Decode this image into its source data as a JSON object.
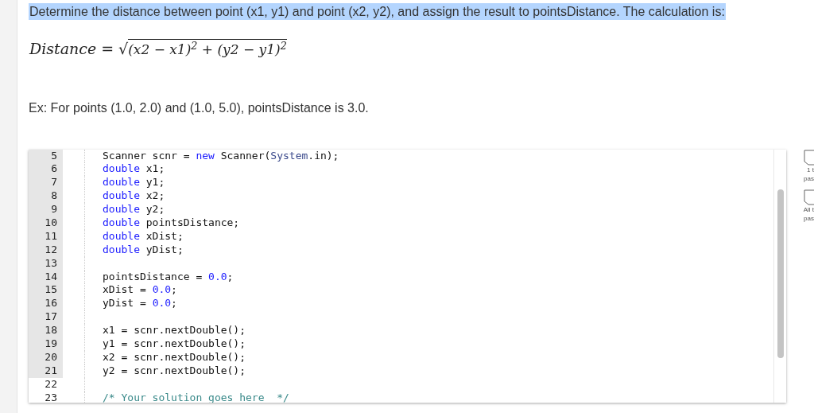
{
  "instruction": {
    "text": "Determine the distance between point (x1, y1) and point (x2, y2), and assign the result to pointsDistance. The calculation is:",
    "highlighted": true
  },
  "formula": {
    "lhs": "Distance",
    "eq": "=",
    "root": "√",
    "radicand": "(x2 − x1)$^{2}$ + (y2 − y1)$^{2}$"
  },
  "example": "Ex: For points (1.0, 2.0) and (1.0, 5.0), pointsDistance is 3.0.",
  "editor": {
    "lines": [
      {
        "number": "5",
        "locked": true,
        "tokens": [
          {
            "kind": "plain",
            "text": "Scanner scnr = "
          },
          {
            "kind": "keyword",
            "text": "new"
          },
          {
            "kind": "plain",
            "text": " Scanner("
          },
          {
            "kind": "type",
            "text": "System"
          },
          {
            "kind": "plain",
            "text": ".in);"
          }
        ]
      },
      {
        "number": "6",
        "locked": true,
        "tokens": [
          {
            "kind": "keyword",
            "text": "double"
          },
          {
            "kind": "plain",
            "text": " x1;"
          }
        ]
      },
      {
        "number": "7",
        "locked": true,
        "tokens": [
          {
            "kind": "keyword",
            "text": "double"
          },
          {
            "kind": "plain",
            "text": " y1;"
          }
        ]
      },
      {
        "number": "8",
        "locked": true,
        "tokens": [
          {
            "kind": "keyword",
            "text": "double"
          },
          {
            "kind": "plain",
            "text": " x2;"
          }
        ]
      },
      {
        "number": "9",
        "locked": true,
        "tokens": [
          {
            "kind": "keyword",
            "text": "double"
          },
          {
            "kind": "plain",
            "text": " y2;"
          }
        ]
      },
      {
        "number": "10",
        "locked": true,
        "tokens": [
          {
            "kind": "keyword",
            "text": "double"
          },
          {
            "kind": "plain",
            "text": " pointsDistance;"
          }
        ]
      },
      {
        "number": "11",
        "locked": true,
        "tokens": [
          {
            "kind": "keyword",
            "text": "double"
          },
          {
            "kind": "plain",
            "text": " xDist;"
          }
        ]
      },
      {
        "number": "12",
        "locked": true,
        "tokens": [
          {
            "kind": "keyword",
            "text": "double"
          },
          {
            "kind": "plain",
            "text": " yDist;"
          }
        ]
      },
      {
        "number": "13",
        "locked": true
      },
      {
        "number": "14",
        "locked": true,
        "tokens": [
          {
            "kind": "plain",
            "text": "pointsDistance = "
          },
          {
            "kind": "number",
            "text": "0.0"
          },
          {
            "kind": "plain",
            "text": ";"
          }
        ]
      },
      {
        "number": "15",
        "locked": true,
        "tokens": [
          {
            "kind": "plain",
            "text": "xDist = "
          },
          {
            "kind": "number",
            "text": "0.0"
          },
          {
            "kind": "plain",
            "text": ";"
          }
        ]
      },
      {
        "number": "16",
        "locked": true,
        "tokens": [
          {
            "kind": "plain",
            "text": "yDist = "
          },
          {
            "kind": "number",
            "text": "0.0"
          },
          {
            "kind": "plain",
            "text": ";"
          }
        ]
      },
      {
        "number": "17",
        "locked": true
      },
      {
        "number": "18",
        "locked": true,
        "tokens": [
          {
            "kind": "plain",
            "text": "x1 = scnr.nextDouble();"
          }
        ]
      },
      {
        "number": "19",
        "locked": true,
        "tokens": [
          {
            "kind": "plain",
            "text": "y1 = scnr.nextDouble();"
          }
        ]
      },
      {
        "number": "20",
        "locked": true,
        "tokens": [
          {
            "kind": "plain",
            "text": "x2 = scnr.nextDouble();"
          }
        ]
      },
      {
        "number": "21",
        "locked": true,
        "tokens": [
          {
            "kind": "plain",
            "text": "y2 = scnr.nextDouble();"
          }
        ]
      },
      {
        "number": "22",
        "locked": false
      },
      {
        "number": "23",
        "locked": false,
        "tokens": [
          {
            "kind": "comment",
            "text": "/* Your solution goes here  */"
          }
        ]
      }
    ]
  },
  "tests": [
    {
      "lines": [
        "1 t",
        "pas"
      ]
    },
    {
      "lines": [
        "All t",
        "pas"
      ]
    }
  ]
}
